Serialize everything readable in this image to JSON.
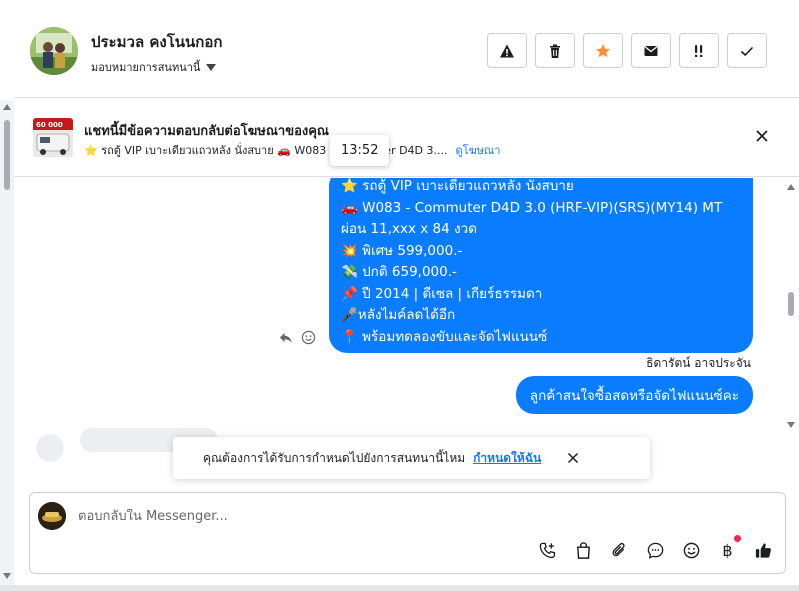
{
  "header": {
    "contact_name": "ประมวล คงโนนกอก",
    "assign_label": "มอบหมายการสนทนานี้",
    "actions": [
      {
        "icon": "warning-icon",
        "label": "!"
      },
      {
        "icon": "trash-icon",
        "label": ""
      },
      {
        "icon": "star-icon",
        "label": ""
      },
      {
        "icon": "mail-icon",
        "label": ""
      },
      {
        "icon": "follow-up-icon",
        "label": "!!"
      },
      {
        "icon": "check-icon",
        "label": ""
      }
    ]
  },
  "banner": {
    "title": "แชทนี้มีข้อความตอบกลับต่อโฆษณาของคุณ",
    "subtitle": "⭐ รถตู้ VIP เบาะเดียวแถวหลัง นั่งสบาย 🚗 W083 - Commuter D4D 3....",
    "link": "ดูโฆษณา",
    "thumb_price": "60 000"
  },
  "tooltip": {
    "time": "13:52"
  },
  "messages": {
    "main_lines": [
      "⭐ รถตู้ VIP เบาะเดียวแถวหลัง นั่งสบาย",
      "🚗 W083 - Commuter D4D 3.0 (HRF-VIP)(SRS)(MY14) MT",
      "ผ่อน 11,xxx x 84 งวด",
      "💥 พิเศษ 599,000.-",
      "💸 ปกติ 659,000.-",
      "📌 ปี 2014 | ดีเซล | เกียร์ธรรมดา",
      "🎤หลังไมค์ลดได้อีก",
      "📍 พร้อมทดลองขับและจัดไฟแนนซ์"
    ],
    "sender": "ธิดารัตน์ อาจประจัน",
    "second": "ลูกค้าสนใจซื้อสดหรือจัดไฟแนนซ์คะ"
  },
  "toast": {
    "question": "คุณต้องการได้รับการกำหนดไปยังการสนทนานี้ไหม",
    "action": "กำหนดให้ฉัน"
  },
  "composer": {
    "placeholder": "ตอบกลับใน Messenger...",
    "tools": [
      "call-plus-icon",
      "shopping-bag-icon",
      "attachment-icon",
      "saved-reply-icon",
      "emoji-icon",
      "baht-icon",
      "like-icon"
    ],
    "baht_symbol": "฿"
  },
  "colors": {
    "accent": "#0a7cff",
    "link": "#1877f2",
    "star": "#f7923b",
    "notify_dot": "#f02849"
  }
}
